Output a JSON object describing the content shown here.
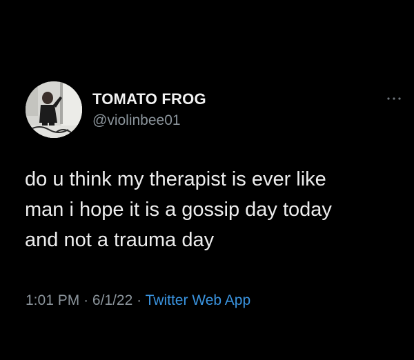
{
  "tweet": {
    "author": {
      "display_name": "TOMATO FROG",
      "handle": "@violinbee01",
      "avatar_icon": "profile-photo"
    },
    "more_icon": "ellipsis-icon",
    "text_lines": [
      "do u think my therapist is ever like",
      "man i hope it is a gossip day today",
      "and not a trauma day"
    ],
    "time": "1:01 PM",
    "separator": "·",
    "date": "6/1/22",
    "source": "Twitter Web App"
  },
  "colors": {
    "background": "#000000",
    "text": "#ededed",
    "muted": "#8b949b",
    "link": "#3a94e0"
  }
}
